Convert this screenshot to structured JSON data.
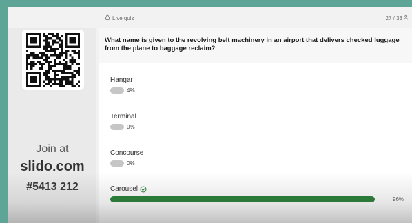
{
  "topbar": {
    "live_label": "Live quiz",
    "counter": "27 / 33"
  },
  "sidebar": {
    "join_text": "Join at",
    "site": "slido.com",
    "code": "#5413 212"
  },
  "question": {
    "text": "What name is given to the revolving belt machinery in an airport that delivers checked luggage from the plane to baggage reclaim?"
  },
  "options": [
    {
      "label": "Hangar",
      "percent": "4%",
      "fraction": 0.04,
      "correct": false
    },
    {
      "label": "Terminal",
      "percent": "0%",
      "fraction": 0.0,
      "correct": false
    },
    {
      "label": "Concourse",
      "percent": "0%",
      "fraction": 0.0,
      "correct": false
    },
    {
      "label": "Carousel",
      "percent": "96%",
      "fraction": 0.96,
      "correct": true
    }
  ],
  "colors": {
    "correct": "#1d7a2c",
    "bar": "#c6c6c6",
    "frame": "#5fa597"
  },
  "icons": {
    "lock": "lock-icon",
    "check": "check-circle-icon",
    "people": "people-icon"
  }
}
